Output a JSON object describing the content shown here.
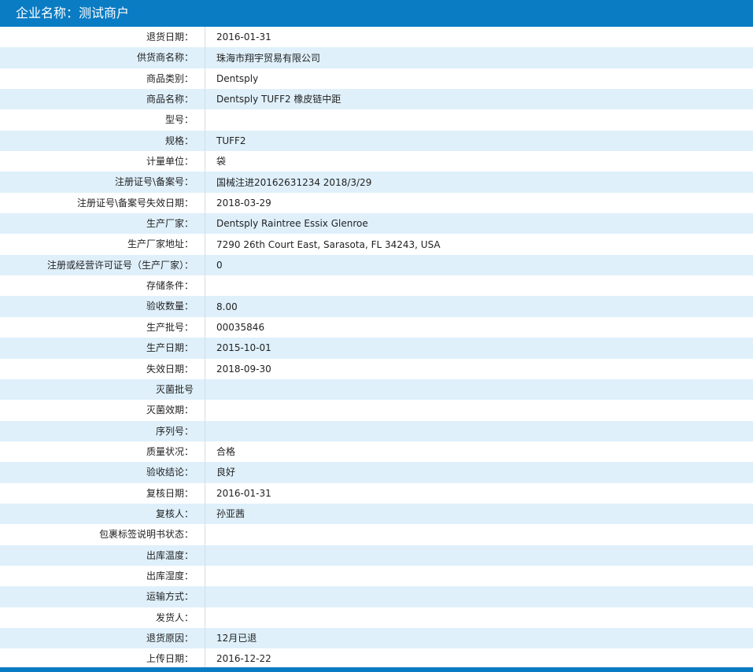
{
  "header": {
    "company_label": "企业名称：",
    "company_name": "测试商户"
  },
  "rows": [
    {
      "label": "退货日期：",
      "value": "2016-01-31"
    },
    {
      "label": "供货商名称：",
      "value": "珠海市翔宇贸易有限公司"
    },
    {
      "label": "商品类别：",
      "value": "Dentsply"
    },
    {
      "label": "商品名称：",
      "value": "Dentsply TUFF2 橡皮链中距"
    },
    {
      "label": "型号：",
      "value": ""
    },
    {
      "label": "规格：",
      "value": "TUFF2"
    },
    {
      "label": "计量单位：",
      "value": "袋"
    },
    {
      "label": "注册证号\\备案号：",
      "value": "国械注进20162631234 2018/3/29"
    },
    {
      "label": "注册证号\\备案号失效日期：",
      "value": "2018-03-29"
    },
    {
      "label": "生产厂家：",
      "value": "Dentsply Raintree Essix Glenroe"
    },
    {
      "label": "生产厂家地址：",
      "value": "7290 26th Court East, Sarasota, FL 34243, USA"
    },
    {
      "label": "注册或经营许可证号（生产厂家）：",
      "value": "0"
    },
    {
      "label": "存储条件：",
      "value": ""
    },
    {
      "label": "验收数量：",
      "value": "8.00"
    },
    {
      "label": "生产批号：",
      "value": "00035846"
    },
    {
      "label": "生产日期：",
      "value": "2015-10-01"
    },
    {
      "label": "失效日期：",
      "value": "2018-09-30"
    },
    {
      "label": "灭菌批号",
      "value": ""
    },
    {
      "label": "灭菌效期：",
      "value": ""
    },
    {
      "label": "序列号：",
      "value": ""
    },
    {
      "label": "质量状况：",
      "value": "合格"
    },
    {
      "label": "验收结论：",
      "value": "良好"
    },
    {
      "label": "复核日期：",
      "value": "2016-01-31"
    },
    {
      "label": "复核人：",
      "value": "孙亚茜"
    },
    {
      "label": "包裹标签说明书状态：",
      "value": ""
    },
    {
      "label": "出库温度：",
      "value": ""
    },
    {
      "label": "出库湿度：",
      "value": ""
    },
    {
      "label": "运输方式：",
      "value": ""
    },
    {
      "label": "发货人：",
      "value": ""
    },
    {
      "label": "退货原因：",
      "value": "12月已退"
    },
    {
      "label": "上传日期：",
      "value": "2016-12-22"
    }
  ],
  "colors": {
    "header_bg": "#0a7cc4",
    "row_alt_bg": "#dff0fb"
  }
}
